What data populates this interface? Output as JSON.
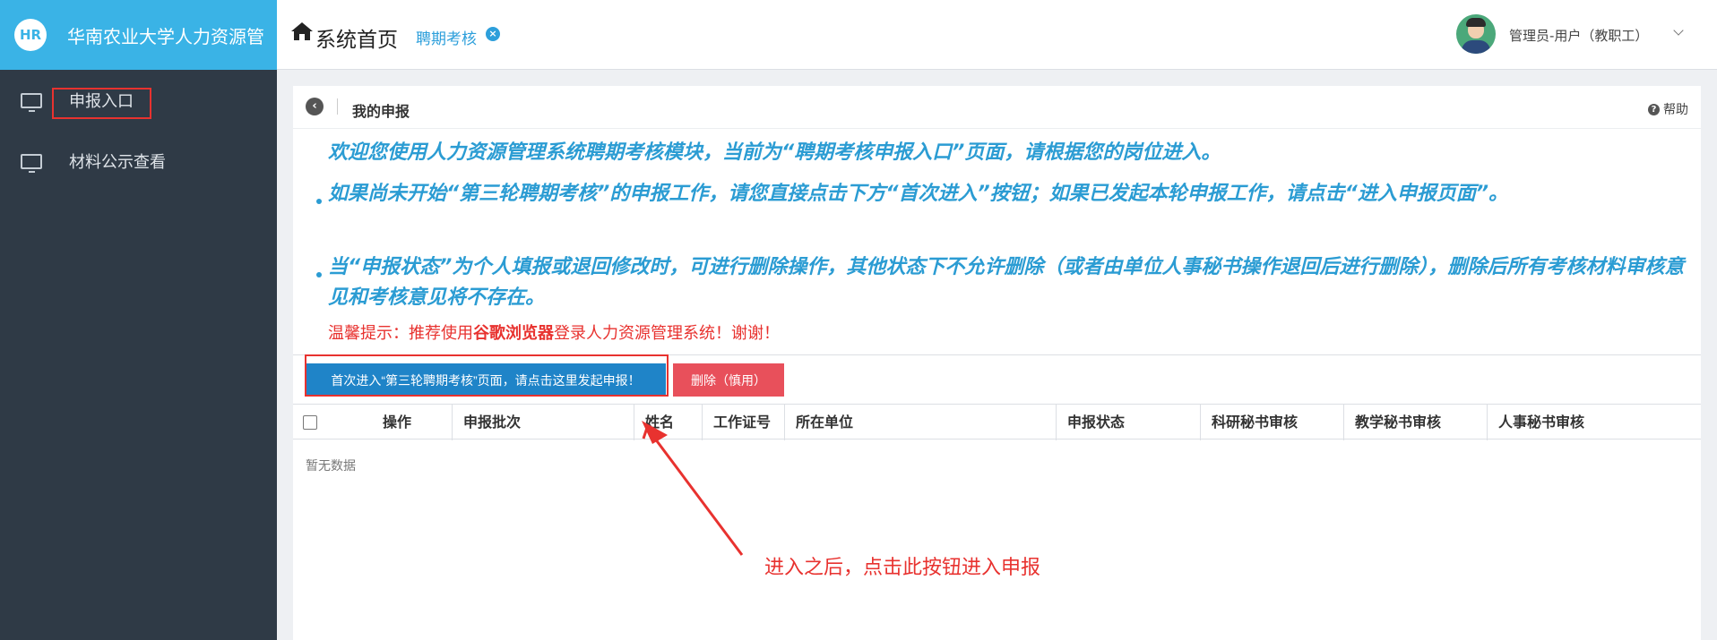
{
  "brand": {
    "logo": "HR",
    "name": "华南农业大学人力资源管"
  },
  "sidebar": {
    "items": [
      {
        "label": "申报入口",
        "icon": "monitor-icon",
        "active": true
      },
      {
        "label": "材料公示查看",
        "icon": "monitor-icon",
        "active": false
      }
    ]
  },
  "header": {
    "title": "系统首页",
    "tab_label": "聘期考核",
    "user": "管理员-用户（教职工）"
  },
  "page": {
    "breadcrumb_title": "我的申报",
    "help": "帮助",
    "notice_intro": "欢迎您使用人力资源管理系统聘期考核模块，当前为“聘期考核申报入口”页面，请根据您的岗位进入。",
    "notice_1": "如果尚未开始“第三轮聘期考核”的申报工作，请您直接点击下方“首次进入”按钮；如果已发起本轮申报工作，请点击“进入申报页面”。",
    "notice_2": "当“申报状态”为个人填报或退回修改时，可进行删除操作，其他状态下不允许删除（或者由单位人事秘书操作退回后进行删除），删除后所有考核材料审核意见和考核意见将不存在。",
    "tip_prefix": "温馨提示：推荐使用",
    "tip_bold": "谷歌浏览器",
    "tip_suffix": "登录人力资源管理系统！谢谢！"
  },
  "toolbar": {
    "first_enter_label": "首次进入“第三轮聘期考核”页面，请点击这里发起申报！",
    "delete_label": "删除（慎用）"
  },
  "table": {
    "columns": [
      "操作",
      "申报批次",
      "姓名",
      "工作证号",
      "所在单位",
      "申报状态",
      "科研秘书审核",
      "教学秘书审核",
      "人事秘书审核"
    ],
    "empty_text": "暂无数据"
  },
  "annotation": {
    "text": "进入之后，点击此按钮进入申报"
  },
  "colors": {
    "brand": "#3ab3e6",
    "sidebar": "#2f3a46",
    "primary": "#1f84c8",
    "danger": "#e8505b",
    "notice": "#2b9cd3",
    "highlight": "#e8322f"
  }
}
